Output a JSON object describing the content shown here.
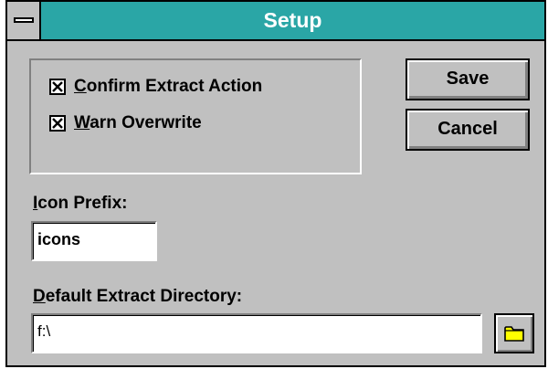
{
  "window": {
    "title": "Setup",
    "sysmenu_icon": "system-menu-icon"
  },
  "options": {
    "confirm_extract": {
      "mnemonic": "C",
      "rest": "onfirm Extract Action",
      "checked": true
    },
    "warn_overwrite": {
      "mnemonic": "W",
      "rest": "arn Overwrite",
      "checked": true
    }
  },
  "buttons": {
    "save_label": "Save",
    "cancel_label": "Cancel"
  },
  "icon_prefix": {
    "label_mnemonic": "I",
    "label_rest": "con Prefix:",
    "value": "icons"
  },
  "extract_dir": {
    "label_mnemonic": "D",
    "label_rest": "efault Extract Directory:",
    "value": "f:\\",
    "browse_icon": "folder-icon"
  },
  "colors": {
    "titlebar": "#2aa6a6",
    "face": "#c0c0c0",
    "folder": "#ffff00"
  }
}
